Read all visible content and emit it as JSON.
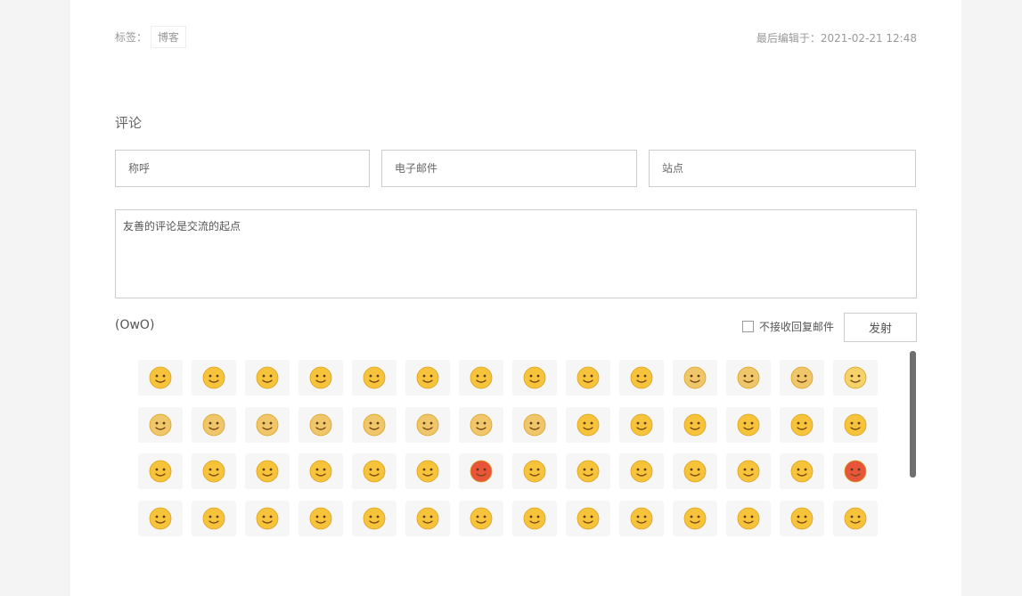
{
  "post_meta": {
    "tags_label": "标签：",
    "tag": "博客",
    "last_edited": "最后编辑于：2021-02-21 12:48"
  },
  "comment": {
    "title": "评论",
    "nick_placeholder": "称呼",
    "mail_placeholder": "电子邮件",
    "site_placeholder": "站点",
    "textarea_placeholder": "友善的评论是交流的起点",
    "owo_toggle": "(OwO)",
    "mail_notify_label": "不接收回复邮件",
    "submit_label": "发射"
  },
  "emoji_panel": {
    "columns": 14,
    "rows": 4,
    "items": [
      {
        "icon": "crying-laughing-icon",
        "face": "#f6c33b"
      },
      {
        "icon": "sunglasses-icon",
        "face": "#f6c33b"
      },
      {
        "icon": "smile-icon",
        "face": "#f6c33b"
      },
      {
        "icon": "grin-icon",
        "face": "#f6c33b"
      },
      {
        "icon": "blush-kiss-icon",
        "face": "#f6c33b"
      },
      {
        "icon": "smirk-icon",
        "face": "#f6c33b"
      },
      {
        "icon": "half-face-icon",
        "face": "#f6c33b"
      },
      {
        "icon": "yawn-icon",
        "face": "#f6c33b"
      },
      {
        "icon": "teary-hug-icon",
        "face": "#f6c33b"
      },
      {
        "icon": "heart-kiss-icon",
        "face": "#f6c33b"
      },
      {
        "icon": "doge-kiss-icon",
        "face": "#f0c66a"
      },
      {
        "icon": "doge-question-icon",
        "face": "#f0c66a"
      },
      {
        "icon": "doge-wink-icon",
        "face": "#f0c66a"
      },
      {
        "icon": "mask-cat-icon",
        "face": "#f6d36a"
      },
      {
        "icon": "doge-sign-icon",
        "face": "#f0c66a"
      },
      {
        "icon": "doge-sweat-icon",
        "face": "#f0c66a"
      },
      {
        "icon": "doge-green-hat-icon",
        "face": "#f0c66a"
      },
      {
        "icon": "doge-sleepy-icon",
        "face": "#f0c66a"
      },
      {
        "icon": "doge-icon",
        "face": "#f0c66a"
      },
      {
        "icon": "doge-bandage-icon",
        "face": "#f0c66a"
      },
      {
        "icon": "doge-hmm-icon",
        "face": "#f0c66a"
      },
      {
        "icon": "doge-cry-icon",
        "face": "#f0c66a"
      },
      {
        "icon": "slight-smile-icon",
        "face": "#f6c33b"
      },
      {
        "icon": "rock-hand-icon",
        "face": "#f6c33b"
      },
      {
        "icon": "yum-icon",
        "face": "#f6c33b"
      },
      {
        "icon": "cover-face-icon",
        "face": "#f6c33b"
      },
      {
        "icon": "squint-laugh-icon",
        "face": "#f6c33b"
      },
      {
        "icon": "heart-eyes-icon",
        "face": "#f6c33b"
      },
      {
        "icon": "pout-icon",
        "face": "#f6c33b"
      },
      {
        "icon": "puppy-eyes-icon",
        "face": "#f6c33b"
      },
      {
        "icon": "hand-over-mouth-icon",
        "face": "#f6c33b"
      },
      {
        "icon": "happy-icon",
        "face": "#f6c33b"
      },
      {
        "icon": "big-grin-icon",
        "face": "#f6c33b"
      },
      {
        "icon": "unamused-icon",
        "face": "#f6c33b"
      },
      {
        "icon": "angry-teeth-icon",
        "face": "#e8553a"
      },
      {
        "icon": "cold-sweat-icon",
        "face": "#f6c33b"
      },
      {
        "icon": "facepalm-icon",
        "face": "#f6c33b"
      },
      {
        "icon": "sob-icon",
        "face": "#f6c33b"
      },
      {
        "icon": "fist-icon",
        "face": "#f6c33b"
      },
      {
        "icon": "vomit-icon",
        "face": "#f6c33b"
      },
      {
        "icon": "shocked-icon",
        "face": "#f6c33b"
      },
      {
        "icon": "angry-red-icon",
        "face": "#e8553a"
      },
      {
        "icon": "hug-icon",
        "face": "#f6c33b"
      },
      {
        "icon": "cool-icon",
        "face": "#f6c33b"
      },
      {
        "icon": "grimace-icon",
        "face": "#f6c33b"
      },
      {
        "icon": "sad-sweat-icon",
        "face": "#f6c33b"
      },
      {
        "icon": "wail-icon",
        "face": "#f6c33b"
      },
      {
        "icon": "question-icon",
        "face": "#f6c33b"
      },
      {
        "icon": "dizzy-icon",
        "face": "#f6c33b"
      },
      {
        "icon": "scream-icon",
        "face": "#f6c33b"
      },
      {
        "icon": "shy-icon",
        "face": "#f6c33b"
      },
      {
        "icon": "shout-icon",
        "face": "#f6c33b"
      },
      {
        "icon": "sleepy-icon",
        "face": "#f6c33b"
      },
      {
        "icon": "tears-of-joy-icon",
        "face": "#f6c33b"
      },
      {
        "icon": "shush-icon",
        "face": "#f6c33b"
      },
      {
        "icon": "green-sick-icon",
        "face": "#f6c33b"
      }
    ]
  }
}
